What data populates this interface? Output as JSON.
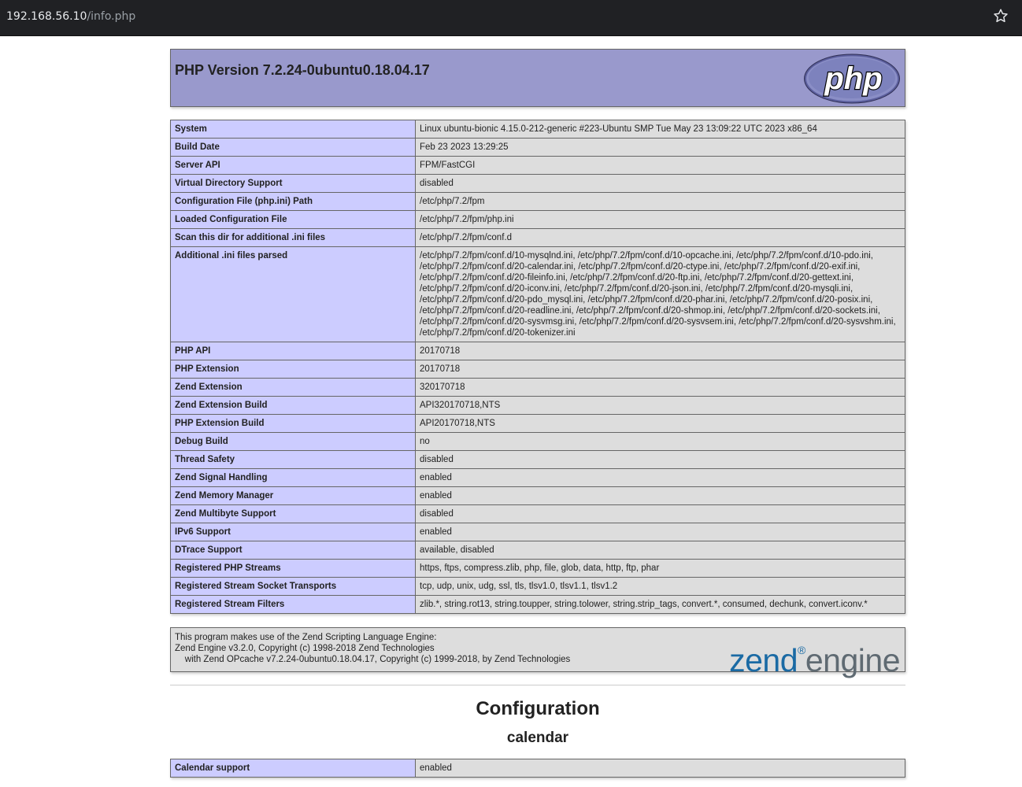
{
  "browser": {
    "url_host": "192.168.56.10",
    "url_path": "/info.php"
  },
  "header": {
    "title": "PHP Version 7.2.24-0ubuntu0.18.04.17",
    "logo_text": "php"
  },
  "general_rows": [
    {
      "label": "System",
      "value": "Linux ubuntu-bionic 4.15.0-212-generic #223-Ubuntu SMP Tue May 23 13:09:22 UTC 2023 x86_64"
    },
    {
      "label": "Build Date",
      "value": "Feb 23 2023 13:29:25"
    },
    {
      "label": "Server API",
      "value": "FPM/FastCGI"
    },
    {
      "label": "Virtual Directory Support",
      "value": "disabled"
    },
    {
      "label": "Configuration File (php.ini) Path",
      "value": "/etc/php/7.2/fpm"
    },
    {
      "label": "Loaded Configuration File",
      "value": "/etc/php/7.2/fpm/php.ini"
    },
    {
      "label": "Scan this dir for additional .ini files",
      "value": "/etc/php/7.2/fpm/conf.d"
    },
    {
      "label": "Additional .ini files parsed",
      "value": "/etc/php/7.2/fpm/conf.d/10-mysqlnd.ini, /etc/php/7.2/fpm/conf.d/10-opcache.ini, /etc/php/7.2/fpm/conf.d/10-pdo.ini, /etc/php/7.2/fpm/conf.d/20-calendar.ini, /etc/php/7.2/fpm/conf.d/20-ctype.ini, /etc/php/7.2/fpm/conf.d/20-exif.ini, /etc/php/7.2/fpm/conf.d/20-fileinfo.ini, /etc/php/7.2/fpm/conf.d/20-ftp.ini, /etc/php/7.2/fpm/conf.d/20-gettext.ini, /etc/php/7.2/fpm/conf.d/20-iconv.ini, /etc/php/7.2/fpm/conf.d/20-json.ini, /etc/php/7.2/fpm/conf.d/20-mysqli.ini, /etc/php/7.2/fpm/conf.d/20-pdo_mysql.ini, /etc/php/7.2/fpm/conf.d/20-phar.ini, /etc/php/7.2/fpm/conf.d/20-posix.ini, /etc/php/7.2/fpm/conf.d/20-readline.ini, /etc/php/7.2/fpm/conf.d/20-shmop.ini, /etc/php/7.2/fpm/conf.d/20-sockets.ini, /etc/php/7.2/fpm/conf.d/20-sysvmsg.ini, /etc/php/7.2/fpm/conf.d/20-sysvsem.ini, /etc/php/7.2/fpm/conf.d/20-sysvshm.ini, /etc/php/7.2/fpm/conf.d/20-tokenizer.ini"
    },
    {
      "label": "PHP API",
      "value": "20170718"
    },
    {
      "label": "PHP Extension",
      "value": "20170718"
    },
    {
      "label": "Zend Extension",
      "value": "320170718"
    },
    {
      "label": "Zend Extension Build",
      "value": "API320170718,NTS"
    },
    {
      "label": "PHP Extension Build",
      "value": "API20170718,NTS"
    },
    {
      "label": "Debug Build",
      "value": "no"
    },
    {
      "label": "Thread Safety",
      "value": "disabled"
    },
    {
      "label": "Zend Signal Handling",
      "value": "enabled"
    },
    {
      "label": "Zend Memory Manager",
      "value": "enabled"
    },
    {
      "label": "Zend Multibyte Support",
      "value": "disabled"
    },
    {
      "label": "IPv6 Support",
      "value": "enabled"
    },
    {
      "label": "DTrace Support",
      "value": "available, disabled"
    },
    {
      "label": "Registered PHP Streams",
      "value": "https, ftps, compress.zlib, php, file, glob, data, http, ftp, phar"
    },
    {
      "label": "Registered Stream Socket Transports",
      "value": "tcp, udp, unix, udg, ssl, tls, tlsv1.0, tlsv1.1, tlsv1.2"
    },
    {
      "label": "Registered Stream Filters",
      "value": "zlib.*, string.rot13, string.toupper, string.tolower, string.strip_tags, convert.*, consumed, dechunk, convert.iconv.*"
    }
  ],
  "zend": {
    "line1": "This program makes use of the Zend Scripting Language Engine:",
    "line2": "Zend Engine v3.2.0, Copyright (c) 1998-2018 Zend Technologies",
    "line3": "    with Zend OPcache v7.2.24-0ubuntu0.18.04.17, Copyright (c) 1999-2018, by Zend Technologies",
    "logo_zend": "zend",
    "logo_engine": "engine"
  },
  "configuration": {
    "heading": "Configuration",
    "module_heading": "calendar",
    "rows": [
      {
        "label": "Calendar support",
        "value": "enabled"
      }
    ]
  },
  "colors": {
    "header_bg": "#9999cc",
    "label_bg": "#ccccff",
    "value_bg": "#dddddd",
    "zend_blue": "#1a6aa4",
    "engine_gray": "#5f6a72"
  },
  "icons": {
    "bookmark": "star-icon"
  }
}
